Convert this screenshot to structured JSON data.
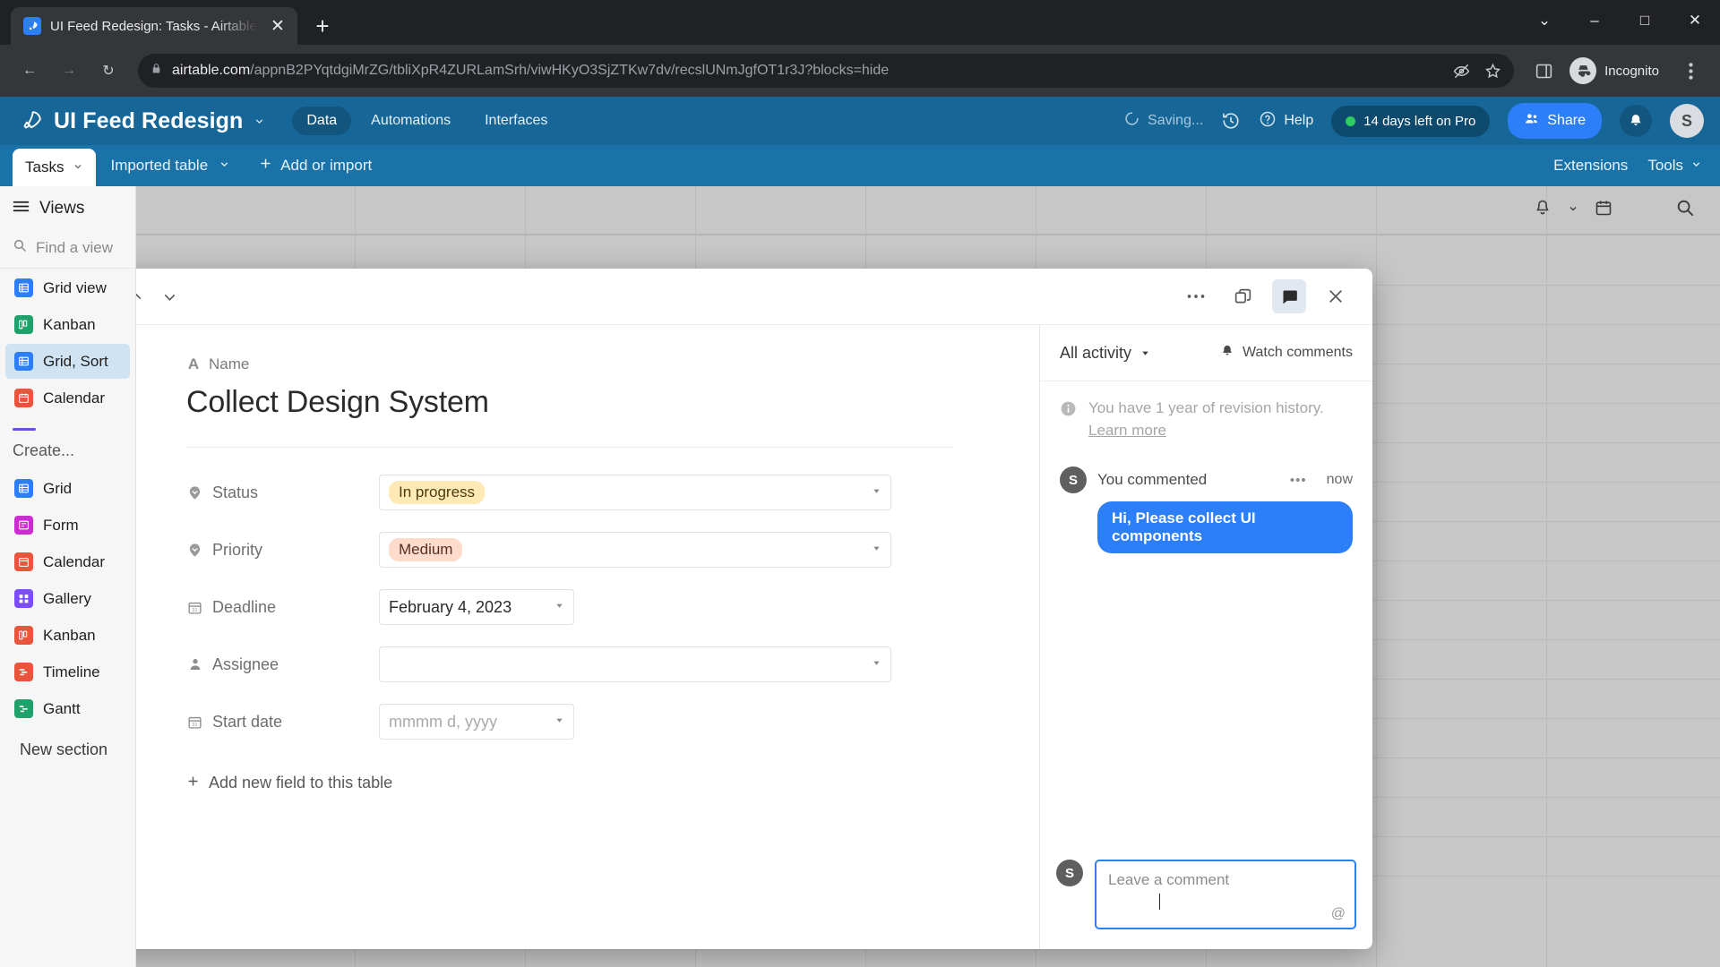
{
  "browser": {
    "tab": {
      "title": "UI Feed Redesign: Tasks - Airtable",
      "favicon": "rocket-icon",
      "close": "✕"
    },
    "newtab_label": "+",
    "window_controls": {
      "minimize": "–",
      "maximize": "□",
      "close": "✕",
      "chevron": "⌄"
    },
    "nav": {
      "back": "←",
      "forward": "→",
      "reload": "↻"
    },
    "omnibox": {
      "lock": "lock-icon",
      "domain": "airtable.com",
      "path": "/appnB2PYqtdgiMrZG/tbliXpR4ZURLamSrh/viwHKyO3SjZTKw7dv/recslUNmJgfOT1r3J?blocks=hide"
    },
    "profile": {
      "label": "Incognito"
    }
  },
  "app_header": {
    "logo": "rocket-icon",
    "base_name": "UI Feed Redesign",
    "nav_tabs": [
      {
        "label": "Data",
        "active": true
      },
      {
        "label": "Automations",
        "active": false
      },
      {
        "label": "Interfaces",
        "active": false
      }
    ],
    "saving_text": "Saving...",
    "history_icon": "history-icon",
    "help_label": "Help",
    "trial_label": "14 days left on Pro",
    "share_label": "Share",
    "notifications_icon": "bell-icon",
    "user_initial": "S"
  },
  "table_bar": {
    "current_table": "Tasks",
    "other_table": "Imported table",
    "add_label": "Add or import",
    "extensions_label": "Extensions",
    "tools_label": "Tools"
  },
  "sidebar": {
    "views_label": "Views",
    "search_placeholder": "Find a view",
    "views": [
      {
        "label": "Grid view",
        "icon": "grid-icon",
        "color": "#2d7ff9",
        "selected": false
      },
      {
        "label": "Kanban",
        "icon": "kanban-icon",
        "color": "#20a06b",
        "selected": false
      },
      {
        "label": "Grid, Sort",
        "icon": "grid-icon",
        "color": "#2d7ff9",
        "selected": true
      },
      {
        "label": "Calendar",
        "icon": "calendar-icon",
        "color": "#e8553c",
        "selected": false
      }
    ],
    "create_label": "Create...",
    "create_items": [
      {
        "label": "Grid",
        "icon": "grid-icon",
        "color": "#2d7ff9"
      },
      {
        "label": "Form",
        "icon": "form-icon",
        "color": "#cb2ed0"
      },
      {
        "label": "Calendar",
        "icon": "calendar-icon",
        "color": "#e8553c"
      },
      {
        "label": "Gallery",
        "icon": "gallery-icon",
        "color": "#7c4dff"
      },
      {
        "label": "Kanban",
        "icon": "kanban-icon",
        "color": "#e8553c"
      },
      {
        "label": "Timeline",
        "icon": "timeline-icon",
        "color": "#e8553c"
      },
      {
        "label": "Gantt",
        "icon": "gantt-icon",
        "color": "#20a06b"
      }
    ],
    "new_section_label": "New section"
  },
  "record": {
    "toolbar": {
      "prev": "⌃",
      "next": "⌄",
      "more": "⋯",
      "copy_icon": "duplicate-icon",
      "comments_icon": "comment-icon",
      "close": "✕"
    },
    "primary_field": {
      "label": "Name",
      "icon": "A",
      "value": "Collect Design System"
    },
    "fields": [
      {
        "label": "Status",
        "icon": "single-select-icon",
        "type": "select",
        "value": "In progress",
        "chip_bg": "#ffeab6",
        "chip_fg": "#4a3c10",
        "width": "wide"
      },
      {
        "label": "Priority",
        "icon": "single-select-icon",
        "type": "select",
        "value": "Medium",
        "chip_bg": "#ffdbcc",
        "chip_fg": "#53301f",
        "width": "wide"
      },
      {
        "label": "Deadline",
        "icon": "date-icon",
        "type": "date",
        "value": "February 4, 2023",
        "placeholder": "",
        "width": "date"
      },
      {
        "label": "Assignee",
        "icon": "user-icon",
        "type": "text",
        "value": "",
        "placeholder": "",
        "width": "wide"
      },
      {
        "label": "Start date",
        "icon": "date-icon",
        "type": "date",
        "value": "",
        "placeholder": "mmmm d, yyyy",
        "width": "date"
      }
    ],
    "add_field_label": "Add new field to this table"
  },
  "comments": {
    "filter_label": "All activity",
    "watch_label": "Watch comments",
    "revision_text": "You have 1 year of revision history.",
    "revision_link": "Learn more",
    "entries": [
      {
        "avatar": "S",
        "author": "You commented",
        "time": "now",
        "menu": "•••",
        "body": "Hi, Please collect UI components"
      }
    ],
    "composer": {
      "avatar": "S",
      "placeholder": "Leave a comment",
      "mention_icon": "@"
    }
  },
  "colors": {
    "airtable_blue": "#166697",
    "accent_blue": "#2d7ff9",
    "status_green": "#2ecc62",
    "selected_view_bg": "#cfe3f2"
  }
}
